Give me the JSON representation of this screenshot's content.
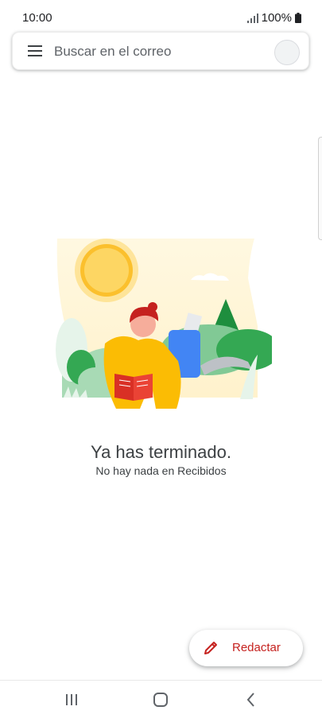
{
  "status_bar": {
    "time": "10:00",
    "battery": "100%",
    "icons": [
      "signal-icon",
      "battery-icon"
    ]
  },
  "search": {
    "placeholder": "Buscar en el correo",
    "menu_icon": "hamburger-menu-icon",
    "avatar": "account-avatar"
  },
  "empty_state": {
    "title": "Ya has terminado.",
    "subtitle": "No hay nada en Recibidos",
    "illustration": "person-reading-in-nature"
  },
  "compose": {
    "label": "Redactar",
    "icon": "pencil-icon",
    "color": "#c5221f"
  },
  "nav_bar": {
    "buttons": [
      "recent-apps-icon",
      "home-icon",
      "back-icon"
    ]
  }
}
